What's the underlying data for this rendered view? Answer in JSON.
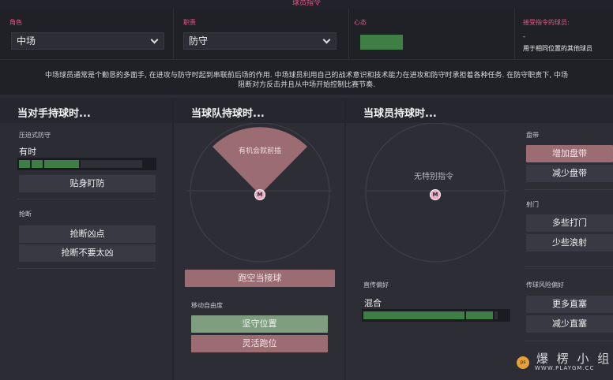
{
  "header": {
    "title": "球员指令"
  },
  "role": {
    "label": "角色",
    "value": "中场"
  },
  "duty": {
    "label": "职责",
    "value": "防守"
  },
  "mentality": {
    "label": "心态",
    "bar_color": "#3f7e45"
  },
  "targets": {
    "label": "接受指令的球员:",
    "line1": "-",
    "line2": "用于相同位置的其他球员"
  },
  "description": {
    "line1": "中场球员通常是个勤恳的多面手, 在进攻与防守时起到串联前后场的作用. 中场球员利用自己的战术意识和技术能力在进攻和防守时承担着各种任务. 在防守职责下, 中场",
    "line2": "阻断对方反击并且从中场开始控制比赛节奏."
  },
  "opp_possession": {
    "heading": "当对手持球时...",
    "pressing": {
      "label": "压迫式防守",
      "value": "有时",
      "level": 0.45
    },
    "mark_button": "贴身盯防",
    "tackling": {
      "label": "抢断",
      "options": [
        "抢断凶点",
        "抢断不要太凶"
      ]
    }
  },
  "team_possession": {
    "heading": "当球队持球时...",
    "zone_label": "有机会就前插",
    "marker": "M",
    "run_button": "跑空当接球",
    "freedom": {
      "label": "移动自由度",
      "hold_button": "坚守位置",
      "roam_button": "灵活跑位"
    }
  },
  "player_possession": {
    "heading": "当球员持球时...",
    "zone_label": "无特别指令",
    "marker": "M",
    "dribble": {
      "label": "盘带",
      "more": "增加盘带",
      "less": "减少盘带"
    },
    "shooting": {
      "label": "射门",
      "more": "多些打门",
      "less": "少些浪射"
    },
    "crossing": {
      "label": "直传偏好",
      "value": "混合",
      "level": 0.85
    },
    "passing_risk": {
      "label": "传球风险偏好",
      "more": "更多直塞",
      "less": "减少直塞"
    }
  },
  "watermark": {
    "text": "爆 楞 小 组",
    "url": "WWW.PLAYGM.CC",
    "logo": "ps"
  },
  "colors": {
    "accent": "#e35b88",
    "green": "#3f7e45",
    "pink_zone": "#9b6c72"
  }
}
